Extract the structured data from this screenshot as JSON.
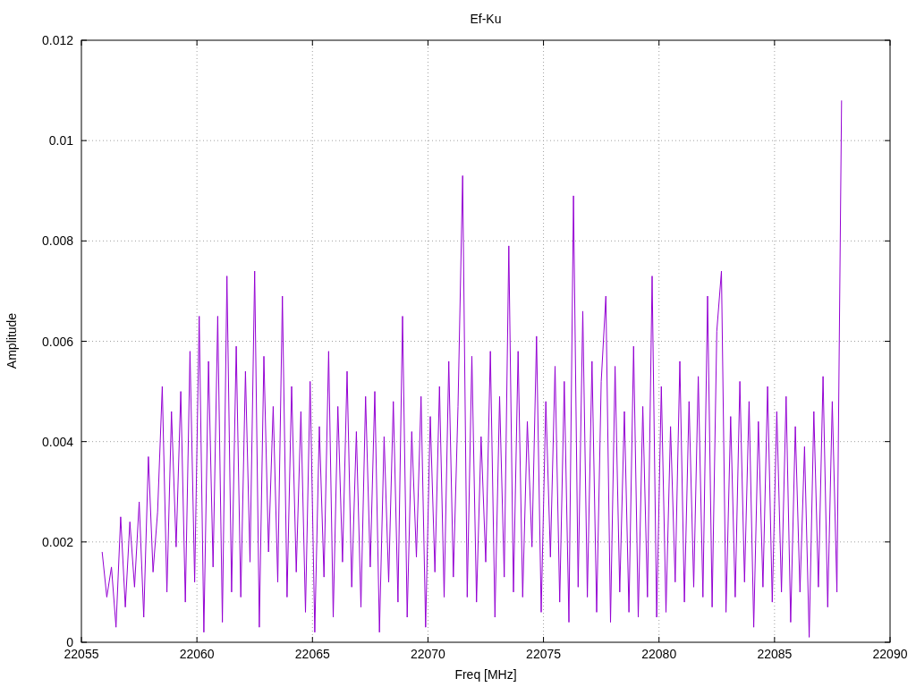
{
  "chart_data": {
    "type": "line",
    "title": "Ef-Ku",
    "xlabel": "Freq [MHz]",
    "ylabel": "Amplitude",
    "grid": true,
    "xlim": [
      22055,
      22090
    ],
    "ylim": [
      0,
      0.012
    ],
    "xticks": [
      22055,
      22060,
      22065,
      22070,
      22075,
      22080,
      22085,
      22090
    ],
    "yticks": [
      0,
      0.002,
      0.004,
      0.006,
      0.008,
      0.01,
      0.012
    ],
    "x": [
      22055.9,
      22056.1,
      22056.3,
      22056.5,
      22056.7,
      22056.9,
      22057.1,
      22057.3,
      22057.5,
      22057.7,
      22057.9,
      22058.1,
      22058.3,
      22058.5,
      22058.7,
      22058.9,
      22059.1,
      22059.3,
      22059.5,
      22059.7,
      22059.9,
      22060.1,
      22060.3,
      22060.5,
      22060.7,
      22060.9,
      22061.1,
      22061.3,
      22061.5,
      22061.7,
      22061.9,
      22062.1,
      22062.3,
      22062.5,
      22062.7,
      22062.9,
      22063.1,
      22063.3,
      22063.5,
      22063.7,
      22063.9,
      22064.1,
      22064.3,
      22064.5,
      22064.7,
      22064.9,
      22065.1,
      22065.3,
      22065.5,
      22065.7,
      22065.9,
      22066.1,
      22066.3,
      22066.5,
      22066.7,
      22066.9,
      22067.1,
      22067.3,
      22067.5,
      22067.7,
      22067.9,
      22068.1,
      22068.3,
      22068.5,
      22068.7,
      22068.9,
      22069.1,
      22069.3,
      22069.5,
      22069.7,
      22069.9,
      22070.1,
      22070.3,
      22070.5,
      22070.7,
      22070.9,
      22071.1,
      22071.3,
      22071.5,
      22071.7,
      22071.9,
      22072.1,
      22072.3,
      22072.5,
      22072.7,
      22072.9,
      22073.1,
      22073.3,
      22073.5,
      22073.7,
      22073.9,
      22074.1,
      22074.3,
      22074.5,
      22074.7,
      22074.9,
      22075.1,
      22075.3,
      22075.5,
      22075.7,
      22075.9,
      22076.1,
      22076.3,
      22076.5,
      22076.7,
      22076.9,
      22077.1,
      22077.3,
      22077.5,
      22077.7,
      22077.9,
      22078.1,
      22078.3,
      22078.5,
      22078.7,
      22078.9,
      22079.1,
      22079.3,
      22079.5,
      22079.7,
      22079.9,
      22080.1,
      22080.3,
      22080.5,
      22080.7,
      22080.9,
      22081.1,
      22081.3,
      22081.5,
      22081.7,
      22081.9,
      22082.1,
      22082.3,
      22082.5,
      22082.7,
      22082.9,
      22083.1,
      22083.3,
      22083.5,
      22083.7,
      22083.9,
      22084.1,
      22084.3,
      22084.5,
      22084.7,
      22084.9,
      22085.1,
      22085.3,
      22085.5,
      22085.7,
      22085.9,
      22086.1,
      22086.3,
      22086.5,
      22086.7,
      22086.9,
      22087.1,
      22087.3,
      22087.5,
      22087.7,
      22087.9
    ],
    "series": [
      {
        "color": "#9400d3",
        "values": [
          0.0018,
          0.0009,
          0.0015,
          0.0003,
          0.0025,
          0.0007,
          0.0024,
          0.0011,
          0.0028,
          0.0005,
          0.0037,
          0.0014,
          0.0026,
          0.0051,
          0.001,
          0.0046,
          0.0019,
          0.005,
          0.0008,
          0.0058,
          0.0012,
          0.0065,
          0.0002,
          0.0056,
          0.0015,
          0.0065,
          0.0004,
          0.0073,
          0.001,
          0.0059,
          0.0009,
          0.0054,
          0.0016,
          0.0074,
          0.0003,
          0.0057,
          0.0018,
          0.0047,
          0.0012,
          0.0069,
          0.0009,
          0.0051,
          0.0014,
          0.0046,
          0.0006,
          0.0052,
          0.0002,
          0.0043,
          0.0013,
          0.0058,
          0.0005,
          0.0047,
          0.0016,
          0.0054,
          0.0011,
          0.0042,
          0.0007,
          0.0049,
          0.0015,
          0.005,
          0.0002,
          0.0041,
          0.0012,
          0.0048,
          0.0008,
          0.0065,
          0.0005,
          0.0042,
          0.0017,
          0.0049,
          0.0003,
          0.0045,
          0.0014,
          0.0051,
          0.0009,
          0.0056,
          0.0013,
          0.0047,
          0.0093,
          0.0009,
          0.0057,
          0.0008,
          0.0041,
          0.0016,
          0.0058,
          0.0005,
          0.0049,
          0.0013,
          0.0079,
          0.001,
          0.0058,
          0.0009,
          0.0044,
          0.0019,
          0.0061,
          0.0006,
          0.0048,
          0.0017,
          0.0055,
          0.0008,
          0.0052,
          0.0004,
          0.0089,
          0.0011,
          0.0066,
          0.0009,
          0.0056,
          0.0006,
          0.0052,
          0.0069,
          0.0004,
          0.0055,
          0.001,
          0.0046,
          0.0006,
          0.0059,
          0.0005,
          0.0047,
          0.0009,
          0.0073,
          0.0005,
          0.0051,
          0.0006,
          0.0043,
          0.0012,
          0.0056,
          0.0008,
          0.0048,
          0.0011,
          0.0053,
          0.0009,
          0.0069,
          0.0007,
          0.0062,
          0.0074,
          0.0006,
          0.0045,
          0.0009,
          0.0052,
          0.0012,
          0.0048,
          0.0003,
          0.0044,
          0.0011,
          0.0051,
          0.0008,
          0.0046,
          0.001,
          0.0049,
          0.0004,
          0.0043,
          0.001,
          0.0039,
          0.0001,
          0.0046,
          0.0011,
          0.0053,
          0.0007,
          0.0048,
          0.001,
          0.0108
        ]
      }
    ]
  }
}
